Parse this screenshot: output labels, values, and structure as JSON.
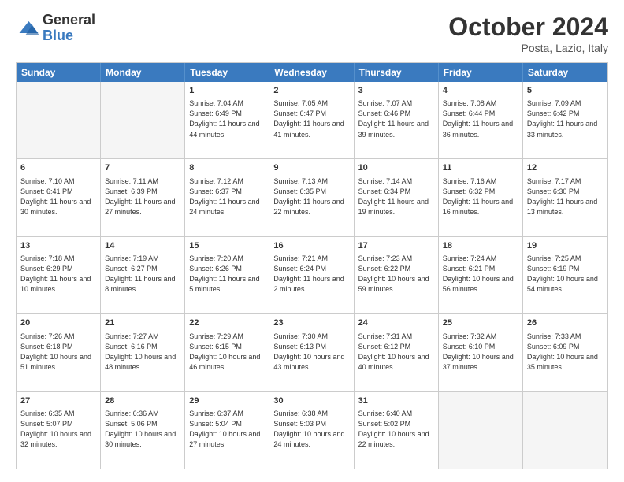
{
  "header": {
    "logo_general": "General",
    "logo_blue": "Blue",
    "month": "October 2024",
    "location": "Posta, Lazio, Italy"
  },
  "days_of_week": [
    "Sunday",
    "Monday",
    "Tuesday",
    "Wednesday",
    "Thursday",
    "Friday",
    "Saturday"
  ],
  "weeks": [
    [
      {
        "day": "",
        "text": "",
        "empty": true
      },
      {
        "day": "",
        "text": "",
        "empty": true
      },
      {
        "day": "1",
        "text": "Sunrise: 7:04 AM\nSunset: 6:49 PM\nDaylight: 11 hours\nand 44 minutes.",
        "empty": false
      },
      {
        "day": "2",
        "text": "Sunrise: 7:05 AM\nSunset: 6:47 PM\nDaylight: 11 hours\nand 41 minutes.",
        "empty": false
      },
      {
        "day": "3",
        "text": "Sunrise: 7:07 AM\nSunset: 6:46 PM\nDaylight: 11 hours\nand 39 minutes.",
        "empty": false
      },
      {
        "day": "4",
        "text": "Sunrise: 7:08 AM\nSunset: 6:44 PM\nDaylight: 11 hours\nand 36 minutes.",
        "empty": false
      },
      {
        "day": "5",
        "text": "Sunrise: 7:09 AM\nSunset: 6:42 PM\nDaylight: 11 hours\nand 33 minutes.",
        "empty": false
      }
    ],
    [
      {
        "day": "6",
        "text": "Sunrise: 7:10 AM\nSunset: 6:41 PM\nDaylight: 11 hours\nand 30 minutes.",
        "empty": false
      },
      {
        "day": "7",
        "text": "Sunrise: 7:11 AM\nSunset: 6:39 PM\nDaylight: 11 hours\nand 27 minutes.",
        "empty": false
      },
      {
        "day": "8",
        "text": "Sunrise: 7:12 AM\nSunset: 6:37 PM\nDaylight: 11 hours\nand 24 minutes.",
        "empty": false
      },
      {
        "day": "9",
        "text": "Sunrise: 7:13 AM\nSunset: 6:35 PM\nDaylight: 11 hours\nand 22 minutes.",
        "empty": false
      },
      {
        "day": "10",
        "text": "Sunrise: 7:14 AM\nSunset: 6:34 PM\nDaylight: 11 hours\nand 19 minutes.",
        "empty": false
      },
      {
        "day": "11",
        "text": "Sunrise: 7:16 AM\nSunset: 6:32 PM\nDaylight: 11 hours\nand 16 minutes.",
        "empty": false
      },
      {
        "day": "12",
        "text": "Sunrise: 7:17 AM\nSunset: 6:30 PM\nDaylight: 11 hours\nand 13 minutes.",
        "empty": false
      }
    ],
    [
      {
        "day": "13",
        "text": "Sunrise: 7:18 AM\nSunset: 6:29 PM\nDaylight: 11 hours\nand 10 minutes.",
        "empty": false
      },
      {
        "day": "14",
        "text": "Sunrise: 7:19 AM\nSunset: 6:27 PM\nDaylight: 11 hours\nand 8 minutes.",
        "empty": false
      },
      {
        "day": "15",
        "text": "Sunrise: 7:20 AM\nSunset: 6:26 PM\nDaylight: 11 hours\nand 5 minutes.",
        "empty": false
      },
      {
        "day": "16",
        "text": "Sunrise: 7:21 AM\nSunset: 6:24 PM\nDaylight: 11 hours\nand 2 minutes.",
        "empty": false
      },
      {
        "day": "17",
        "text": "Sunrise: 7:23 AM\nSunset: 6:22 PM\nDaylight: 10 hours\nand 59 minutes.",
        "empty": false
      },
      {
        "day": "18",
        "text": "Sunrise: 7:24 AM\nSunset: 6:21 PM\nDaylight: 10 hours\nand 56 minutes.",
        "empty": false
      },
      {
        "day": "19",
        "text": "Sunrise: 7:25 AM\nSunset: 6:19 PM\nDaylight: 10 hours\nand 54 minutes.",
        "empty": false
      }
    ],
    [
      {
        "day": "20",
        "text": "Sunrise: 7:26 AM\nSunset: 6:18 PM\nDaylight: 10 hours\nand 51 minutes.",
        "empty": false
      },
      {
        "day": "21",
        "text": "Sunrise: 7:27 AM\nSunset: 6:16 PM\nDaylight: 10 hours\nand 48 minutes.",
        "empty": false
      },
      {
        "day": "22",
        "text": "Sunrise: 7:29 AM\nSunset: 6:15 PM\nDaylight: 10 hours\nand 46 minutes.",
        "empty": false
      },
      {
        "day": "23",
        "text": "Sunrise: 7:30 AM\nSunset: 6:13 PM\nDaylight: 10 hours\nand 43 minutes.",
        "empty": false
      },
      {
        "day": "24",
        "text": "Sunrise: 7:31 AM\nSunset: 6:12 PM\nDaylight: 10 hours\nand 40 minutes.",
        "empty": false
      },
      {
        "day": "25",
        "text": "Sunrise: 7:32 AM\nSunset: 6:10 PM\nDaylight: 10 hours\nand 37 minutes.",
        "empty": false
      },
      {
        "day": "26",
        "text": "Sunrise: 7:33 AM\nSunset: 6:09 PM\nDaylight: 10 hours\nand 35 minutes.",
        "empty": false
      }
    ],
    [
      {
        "day": "27",
        "text": "Sunrise: 6:35 AM\nSunset: 5:07 PM\nDaylight: 10 hours\nand 32 minutes.",
        "empty": false
      },
      {
        "day": "28",
        "text": "Sunrise: 6:36 AM\nSunset: 5:06 PM\nDaylight: 10 hours\nand 30 minutes.",
        "empty": false
      },
      {
        "day": "29",
        "text": "Sunrise: 6:37 AM\nSunset: 5:04 PM\nDaylight: 10 hours\nand 27 minutes.",
        "empty": false
      },
      {
        "day": "30",
        "text": "Sunrise: 6:38 AM\nSunset: 5:03 PM\nDaylight: 10 hours\nand 24 minutes.",
        "empty": false
      },
      {
        "day": "31",
        "text": "Sunrise: 6:40 AM\nSunset: 5:02 PM\nDaylight: 10 hours\nand 22 minutes.",
        "empty": false
      },
      {
        "day": "",
        "text": "",
        "empty": true
      },
      {
        "day": "",
        "text": "",
        "empty": true
      }
    ]
  ]
}
